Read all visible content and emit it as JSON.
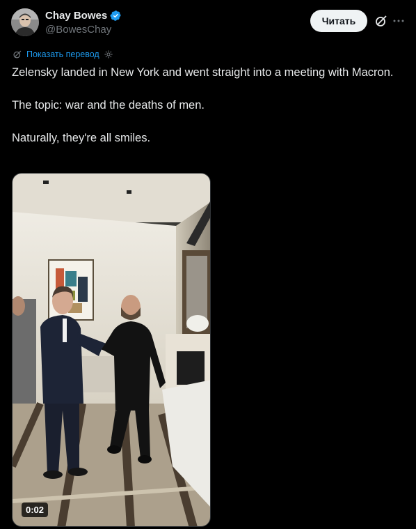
{
  "author": {
    "display_name": "Chay Bowes",
    "handle": "@BowesChay",
    "verified": true,
    "avatar_icon": "profile-photo"
  },
  "actions": {
    "follow_label": "Читать",
    "grok_icon": "grok-icon",
    "more_icon": "more-horizontal-icon"
  },
  "translate": {
    "label": "Показать перевод",
    "icon": "grok-icon",
    "settings_icon": "gear-icon"
  },
  "tweet": {
    "paragraphs": [
      "Zelensky landed in New York and went straight into a meeting with Macron.",
      "The topic: war and the deaths of men.",
      "Naturally, they're all smiles."
    ]
  },
  "media": {
    "type": "video",
    "duration": "0:02"
  },
  "colors": {
    "background": "#000000",
    "text": "#e7e9ea",
    "muted": "#71767b",
    "accent": "#1d9bf0",
    "button_bg": "#eff3f4"
  }
}
